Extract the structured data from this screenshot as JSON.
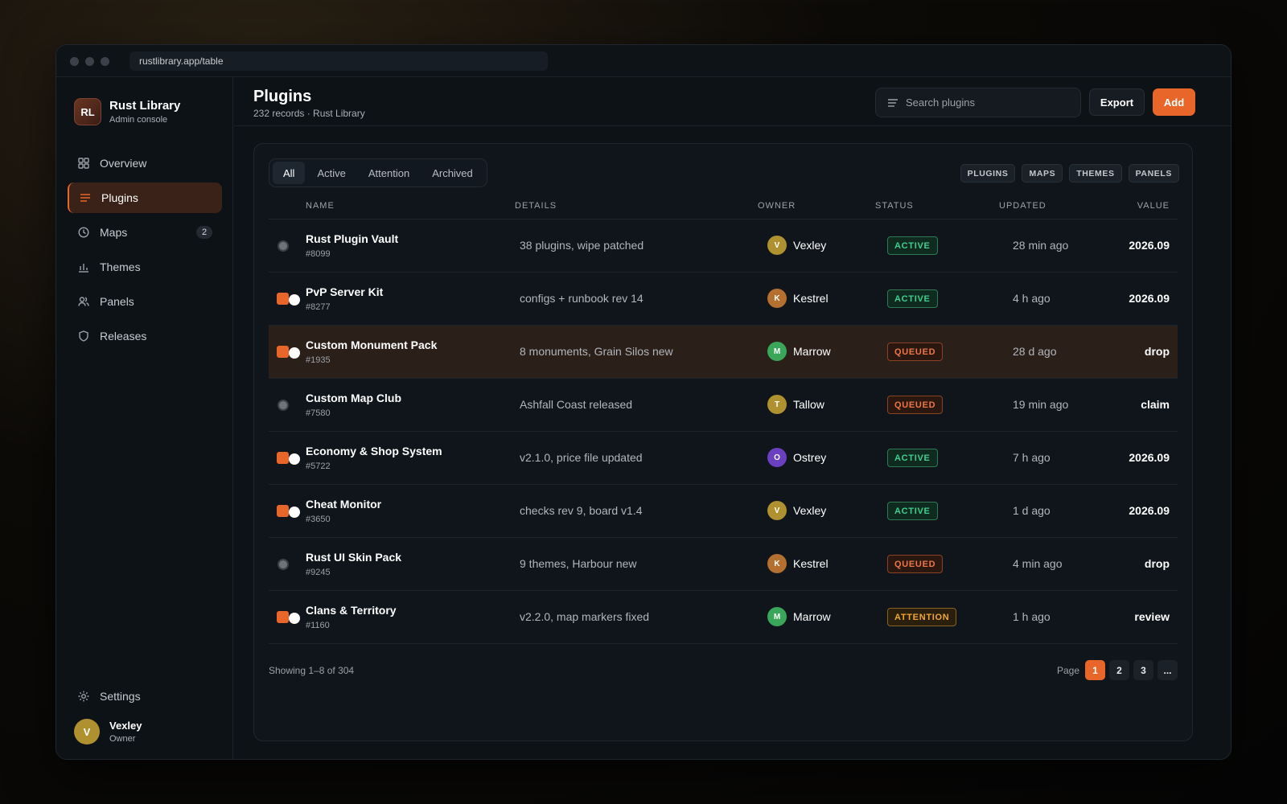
{
  "browser": {
    "url": "rustlibrary.app/table"
  },
  "brand": {
    "logo": "RL",
    "title": "Rust Library",
    "subtitle": "Admin console"
  },
  "nav": [
    {
      "label": "Overview",
      "icon": "grid-icon"
    },
    {
      "label": "Plugins",
      "icon": "list-icon",
      "active": true
    },
    {
      "label": "Maps",
      "icon": "clock-icon",
      "badge": "2"
    },
    {
      "label": "Themes",
      "icon": "bar-chart-icon"
    },
    {
      "label": "Panels",
      "icon": "users-icon"
    },
    {
      "label": "Releases",
      "icon": "shield-icon"
    }
  ],
  "settings_label": "Settings",
  "user": {
    "initial": "V",
    "name": "Vexley",
    "role": "Owner"
  },
  "header": {
    "title": "Plugins",
    "subtitle": "232 records · Rust Library"
  },
  "search": {
    "placeholder": "Search plugins"
  },
  "actions": {
    "export": "Export",
    "add": "Add"
  },
  "tabs": [
    "All",
    "Active",
    "Attention",
    "Archived"
  ],
  "categories": [
    "PLUGINS",
    "MAPS",
    "THEMES",
    "PANELS"
  ],
  "columns": {
    "name": "NAME",
    "details": "DETAILS",
    "owner": "OWNER",
    "status": "STATUS",
    "updated": "UPDATED",
    "value": "VALUE"
  },
  "rows": [
    {
      "name": "Rust Plugin Vault",
      "id": "#8099",
      "details": "38 plugins, wipe patched",
      "owner": "Vexley",
      "owner_initial": "V",
      "owner_color": "#b0912f",
      "status": "ACTIVE",
      "updated": "28 min ago",
      "value": "2026.09",
      "selected": false
    },
    {
      "name": "PvP Server Kit",
      "id": "#8277",
      "details": "configs + runbook rev 14",
      "owner": "Kestrel",
      "owner_initial": "K",
      "owner_color": "#b3702e",
      "status": "ACTIVE",
      "updated": "4 h ago",
      "value": "2026.09",
      "selected": true
    },
    {
      "name": "Custom Monument Pack",
      "id": "#1935",
      "details": "8 monuments, Grain Silos new",
      "owner": "Marrow",
      "owner_initial": "M",
      "owner_color": "#3aa65a",
      "status": "QUEUED",
      "updated": "28 d ago",
      "value": "drop",
      "selected": true,
      "highlight": true
    },
    {
      "name": "Custom Map Club",
      "id": "#7580",
      "details": "Ashfall Coast released",
      "owner": "Tallow",
      "owner_initial": "T",
      "owner_color": "#b0912f",
      "status": "QUEUED",
      "updated": "19 min ago",
      "value": "claim",
      "selected": false
    },
    {
      "name": "Economy & Shop System",
      "id": "#5722",
      "details": "v2.1.0, price file updated",
      "owner": "Ostrey",
      "owner_initial": "O",
      "owner_color": "#6a3fc0",
      "status": "ACTIVE",
      "updated": "7 h ago",
      "value": "2026.09",
      "selected": true
    },
    {
      "name": "Cheat Monitor",
      "id": "#3650",
      "details": "checks rev 9, board v1.4",
      "owner": "Vexley",
      "owner_initial": "V",
      "owner_color": "#b0912f",
      "status": "ACTIVE",
      "updated": "1 d ago",
      "value": "2026.09",
      "selected": true
    },
    {
      "name": "Rust UI Skin Pack",
      "id": "#9245",
      "details": "9 themes, Harbour new",
      "owner": "Kestrel",
      "owner_initial": "K",
      "owner_color": "#b3702e",
      "status": "QUEUED",
      "updated": "4 min ago",
      "value": "drop",
      "selected": false
    },
    {
      "name": "Clans & Territory",
      "id": "#1160",
      "details": "v2.2.0, map markers fixed",
      "owner": "Marrow",
      "owner_initial": "M",
      "owner_color": "#3aa65a",
      "status": "ATTENTION",
      "updated": "1 h ago",
      "value": "review",
      "selected": true
    }
  ],
  "footer": {
    "showing": "Showing 1–8 of 304",
    "page_label": "Page",
    "pages": [
      "1",
      "2",
      "3",
      "..."
    ]
  },
  "colors": {
    "accent": "#e8662a",
    "active": "#3ecf8e",
    "queued": "#ee7740",
    "attention": "#f0a637"
  }
}
